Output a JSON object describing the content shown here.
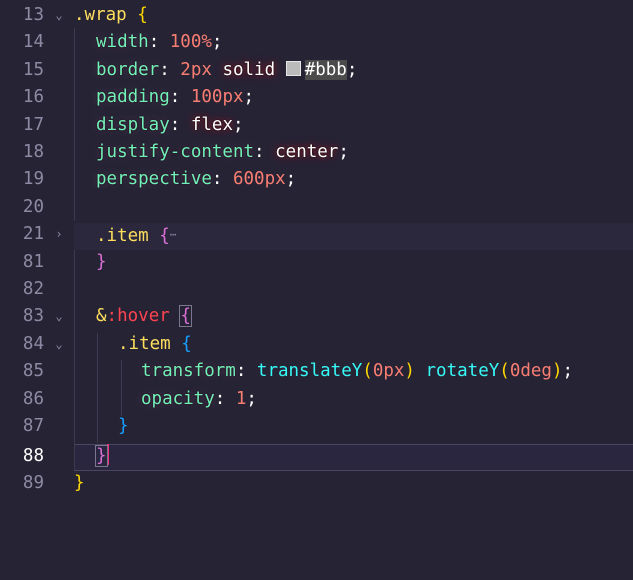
{
  "editor": {
    "lines": [
      {
        "num": "13",
        "fold": "⌄",
        "code": [
          ".wrap",
          " ",
          "{"
        ]
      },
      {
        "num": "14",
        "code": [
          "width",
          ": ",
          "100%",
          ";"
        ]
      },
      {
        "num": "15",
        "code": [
          "border",
          ": ",
          "2px",
          " ",
          "solid",
          " ",
          "#bbb",
          ";"
        ]
      },
      {
        "num": "16",
        "code": [
          "padding",
          ": ",
          "100px",
          ";"
        ]
      },
      {
        "num": "17",
        "code": [
          "display",
          ": ",
          "flex",
          ";"
        ]
      },
      {
        "num": "18",
        "code": [
          "justify-content",
          ": ",
          "center",
          ";"
        ]
      },
      {
        "num": "19",
        "code": [
          "perspective",
          ": ",
          "600px",
          ";"
        ]
      },
      {
        "num": "20",
        "code": []
      },
      {
        "num": "21",
        "fold": "›",
        "code": [
          ".item",
          " ",
          "{",
          "⋯"
        ]
      },
      {
        "num": "81",
        "code": [
          "}"
        ]
      },
      {
        "num": "82",
        "code": []
      },
      {
        "num": "83",
        "fold": "⌄",
        "code": [
          "&",
          ":hover",
          " ",
          "{"
        ]
      },
      {
        "num": "84",
        "fold": "⌄",
        "code": [
          ".item",
          " ",
          "{"
        ]
      },
      {
        "num": "85",
        "code": [
          "transform",
          ": ",
          "translateY",
          "(",
          "0px",
          ")",
          " ",
          "rotateY",
          "(",
          "0deg",
          ")",
          ";"
        ]
      },
      {
        "num": "86",
        "code": [
          "opacity",
          ": ",
          "1",
          ";"
        ]
      },
      {
        "num": "87",
        "code": [
          "}"
        ]
      },
      {
        "num": "88",
        "code": [
          "}"
        ]
      },
      {
        "num": "89",
        "code": [
          "}"
        ]
      }
    ],
    "colors": {
      "background": "#262335",
      "selector": "#fede5d",
      "property": "#72f1b8",
      "number": "#f97e72",
      "keyword": "#fdfdfd",
      "brace_level1": "#ffd700",
      "brace_level2": "#da70d6",
      "brace_level3": "#179fff",
      "pseudo": "#fe4450",
      "function": "#36f9f6",
      "swatch": "#bbbbbb"
    }
  }
}
